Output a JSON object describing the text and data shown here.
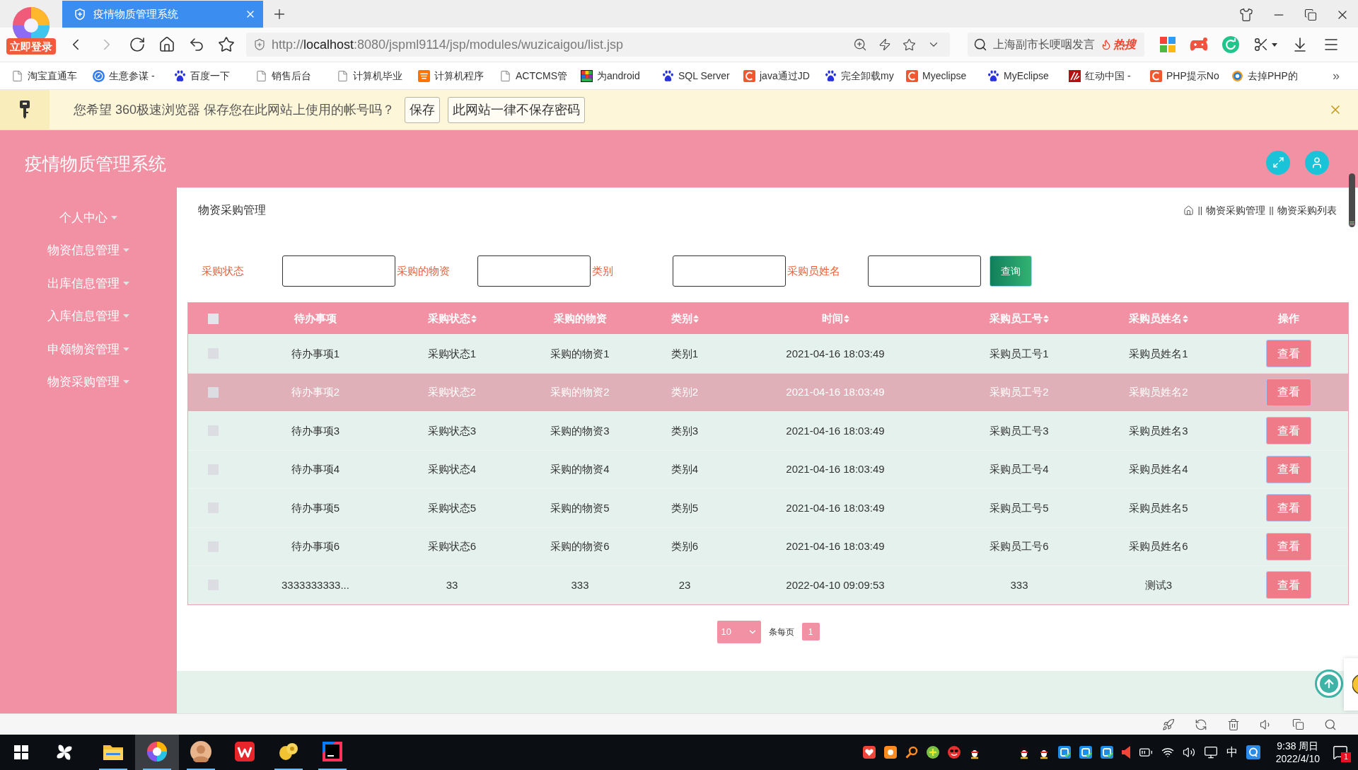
{
  "browser": {
    "login_badge": "立即登录",
    "tab": {
      "title": "疫情物质管理系统",
      "selected": true
    },
    "nav": {
      "forward_disabled": true
    },
    "address": {
      "scheme": "http://",
      "host": "localhost",
      "path": ":8080/jspml9114/jsp/modules/wuzicaigou/list.jsp"
    },
    "search": {
      "value": "上海副市长哽咽发言",
      "hot_label": "热搜"
    },
    "bookmarks": [
      {
        "label": "淘宝直通车",
        "kind": "page"
      },
      {
        "label": "生意参谋 -",
        "kind": "compass"
      },
      {
        "label": "百度一下",
        "kind": "paw"
      },
      {
        "label": "销售后台",
        "kind": "page"
      },
      {
        "label": "计算机毕业",
        "kind": "page"
      },
      {
        "label": "计算机程序",
        "kind": "shop"
      },
      {
        "label": "ACTCMS管",
        "kind": "page"
      },
      {
        "label": "为android",
        "kind": "mosaic"
      },
      {
        "label": "SQL Server",
        "kind": "paw"
      },
      {
        "label": "java通过JD",
        "kind": "arc"
      },
      {
        "label": "完全卸载my",
        "kind": "paw"
      },
      {
        "label": "Myeclipse",
        "kind": "arc"
      },
      {
        "label": "MyEclipse",
        "kind": "paw"
      },
      {
        "label": "红动中国 -",
        "kind": "brush"
      },
      {
        "label": "PHP提示No",
        "kind": "arc"
      },
      {
        "label": "去掉PHP的",
        "kind": "ring"
      }
    ],
    "bookmarks_more": "»"
  },
  "password_bar": {
    "message": "您希望 360极速浏览器 保存您在此网站上使用的帐号吗？",
    "buttons": [
      {
        "label": "保存"
      },
      {
        "label": "此网站一律不保存密码"
      }
    ]
  },
  "app": {
    "title": "疫情物质管理系统"
  },
  "sidebar": {
    "items": [
      {
        "label": "个人中心"
      },
      {
        "label": "物资信息管理"
      },
      {
        "label": "出库信息管理"
      },
      {
        "label": "入库信息管理"
      },
      {
        "label": "申领物资管理"
      },
      {
        "label": "物资采购管理"
      }
    ]
  },
  "page": {
    "title": "物资采购管理",
    "breadcrumb": [
      {
        "separator": "||",
        "label": "物资采购管理"
      },
      {
        "separator": "||",
        "label": "物资采购列表"
      }
    ]
  },
  "search_form": {
    "fields": [
      {
        "label": "采购状态"
      },
      {
        "label": "采购的物资"
      },
      {
        "label": "类别"
      },
      {
        "label": "采购员姓名"
      }
    ],
    "submit": "查询"
  },
  "table": {
    "select_all_checked": false,
    "columns": [
      {
        "label": "待办事项",
        "sortable": false
      },
      {
        "label": "采购状态",
        "sortable": true
      },
      {
        "label": "采购的物资",
        "sortable": false
      },
      {
        "label": "类别",
        "sortable": true
      },
      {
        "label": "时间",
        "sortable": true
      },
      {
        "label": "采购员工号",
        "sortable": true
      },
      {
        "label": "采购员姓名",
        "sortable": true
      },
      {
        "label": "操作",
        "sortable": false
      }
    ],
    "rows": [
      {
        "cells": [
          "待办事项1",
          "采购状态1",
          "采购的物资1",
          "类别1",
          "2021-04-16 18:03:49",
          "采购员工号1",
          "采购员姓名1"
        ],
        "action": "查看",
        "checked": false,
        "hovered": false
      },
      {
        "cells": [
          "待办事项2",
          "采购状态2",
          "采购的物资2",
          "类别2",
          "2021-04-16 18:03:49",
          "采购员工号2",
          "采购员姓名2"
        ],
        "action": "查看",
        "checked": false,
        "hovered": true
      },
      {
        "cells": [
          "待办事项3",
          "采购状态3",
          "采购的物资3",
          "类别3",
          "2021-04-16 18:03:49",
          "采购员工号3",
          "采购员姓名3"
        ],
        "action": "查看",
        "checked": false,
        "hovered": false
      },
      {
        "cells": [
          "待办事项4",
          "采购状态4",
          "采购的物资4",
          "类别4",
          "2021-04-16 18:03:49",
          "采购员工号4",
          "采购员姓名4"
        ],
        "action": "查看",
        "checked": false,
        "hovered": false
      },
      {
        "cells": [
          "待办事项5",
          "采购状态5",
          "采购的物资5",
          "类别5",
          "2021-04-16 18:03:49",
          "采购员工号5",
          "采购员姓名5"
        ],
        "action": "查看",
        "checked": false,
        "hovered": false
      },
      {
        "cells": [
          "待办事项6",
          "采购状态6",
          "采购的物资6",
          "类别6",
          "2021-04-16 18:03:49",
          "采购员工号6",
          "采购员姓名6"
        ],
        "action": "查看",
        "checked": false,
        "hovered": false
      },
      {
        "cells": [
          "3333333333...",
          "33",
          "333",
          "23",
          "2022-04-10 09:09:53",
          "333",
          "测试3"
        ],
        "action": "查看",
        "checked": false,
        "hovered": false
      }
    ]
  },
  "pagination": {
    "page_size": "10",
    "per_page_label": "条每页",
    "pages": [
      {
        "label": "1",
        "selected": true
      }
    ]
  },
  "taskbar": {
    "apps": [
      {
        "kind": "folder",
        "running": true,
        "active": false
      },
      {
        "kind": "browser",
        "running": true,
        "active": true
      },
      {
        "kind": "avatar",
        "running": true,
        "active": false
      },
      {
        "kind": "wps",
        "running": false,
        "active": false
      },
      {
        "kind": "nut",
        "running": true,
        "active": false
      },
      {
        "kind": "ide",
        "running": true,
        "active": false
      }
    ],
    "ime": "中",
    "time": "9:38 周日",
    "date": "2022/4/10",
    "notifications": "1"
  }
}
